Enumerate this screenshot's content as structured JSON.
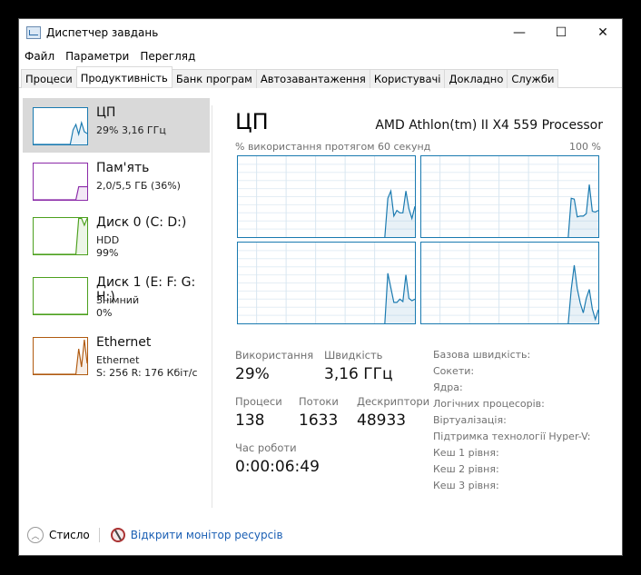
{
  "window": {
    "title": "Диспетчер завдань",
    "minimize": "—",
    "maximize": "☐",
    "close": "✕"
  },
  "menu": [
    "Файл",
    "Параметри",
    "Перегляд"
  ],
  "tabs": [
    "Процеси",
    "Продуктивність",
    "Банк програм",
    "Автозавантаження",
    "Користувачі",
    "Докладно",
    "Служби"
  ],
  "sidebar": [
    {
      "name": "ЦП",
      "line1": "29% 3,16 ГГц",
      "line2": "",
      "color": "#1a7ab0",
      "values": [
        0,
        0,
        0,
        0,
        0,
        0,
        0,
        0,
        0,
        0,
        0,
        0,
        0,
        0,
        40,
        55,
        28,
        60,
        35,
        30
      ]
    },
    {
      "name": "Пам'ять",
      "line1": "2,0/5,5 ГБ (36%)",
      "line2": "",
      "color": "#8b2aa8",
      "values": [
        0,
        0,
        0,
        0,
        0,
        0,
        0,
        0,
        0,
        0,
        0,
        0,
        0,
        0,
        0,
        0,
        36,
        36,
        36,
        36
      ]
    },
    {
      "name": "Диск 0 (C: D:)",
      "line1": "HDD",
      "line2": "99%",
      "color": "#4ca01e",
      "values": [
        0,
        0,
        0,
        0,
        0,
        0,
        0,
        0,
        0,
        0,
        0,
        0,
        0,
        0,
        0,
        0,
        99,
        99,
        80,
        99
      ]
    },
    {
      "name": "Диск 1 (E: F: G: H:)",
      "line1": "Знімний",
      "line2": "0%",
      "color": "#4ca01e",
      "values": [
        0,
        0,
        0,
        0,
        0,
        0,
        0,
        0,
        0,
        0,
        0,
        0,
        0,
        0,
        0,
        0,
        0,
        0,
        0,
        0
      ]
    },
    {
      "name": "Ethernet",
      "line1": "Ethernet",
      "line2": "S: 256 R: 176 Кбіт/с",
      "color": "#b05a10",
      "values": [
        0,
        0,
        0,
        0,
        0,
        0,
        0,
        0,
        0,
        0,
        0,
        0,
        0,
        0,
        0,
        0,
        70,
        20,
        95,
        30
      ]
    }
  ],
  "main": {
    "title": "ЦП",
    "model": "AMD Athlon(tm) II X4 559 Processor",
    "caption": "% використання протягом 60 секунд",
    "max": "100 %",
    "cores": [
      [
        0,
        48,
        57,
        26,
        33,
        30,
        30,
        57,
        35,
        23,
        38
      ],
      [
        0,
        48,
        47,
        25,
        26,
        26,
        29,
        65,
        32,
        31,
        33
      ],
      [
        0,
        62,
        44,
        26,
        26,
        30,
        27,
        60,
        31,
        28,
        30
      ],
      [
        0,
        42,
        72,
        43,
        25,
        13,
        31,
        42,
        18,
        5,
        17
      ]
    ],
    "stats": {
      "usage_label": "Використання",
      "usage": "29%",
      "speed_label": "Швидкість",
      "speed": "3,16 ГГц",
      "proc_label": "Процеси",
      "proc": "138",
      "threads_label": "Потоки",
      "threads": "1633",
      "handles_label": "Дескриптори",
      "handles": "48933",
      "uptime_label": "Час роботи",
      "uptime": "0:00:06:49"
    },
    "info": [
      "Базова швидкість:",
      "Сокети:",
      "Ядра:",
      "Логічних процесорів:",
      "Віртуалізація:",
      "Підтримка технології Hyper-V:",
      "Кеш 1 рівня:",
      "Кеш 2 рівня:",
      "Кеш 3 рівня:"
    ]
  },
  "footer": {
    "collapse": "Стисло",
    "monitor": "Відкрити монітор ресурсів"
  }
}
